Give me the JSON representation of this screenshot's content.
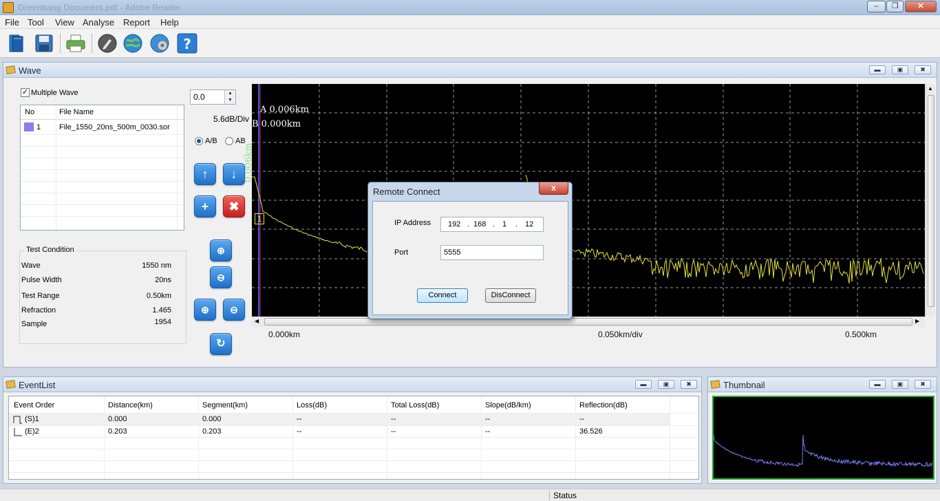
{
  "window": {
    "title": "Greenbang Document.pdf - Adobe Reader"
  },
  "menu": {
    "file": "File",
    "tool": "Tool",
    "view": "View",
    "analyse": "Analyse",
    "report": "Report",
    "help": "Help"
  },
  "toolbar_icons": [
    "open-file-icon",
    "save-icon",
    "print-icon",
    "edit-icon",
    "globe-icon",
    "network-settings-icon",
    "help-icon"
  ],
  "wave": {
    "title": "Wave",
    "multiple_wave_label": "Multiple Wave",
    "multiple_wave_checked": true,
    "table": {
      "col_no": "No",
      "col_file": "File Name",
      "rows": [
        {
          "no": "1",
          "file": "File_1550_20ns_500m_0030.sor",
          "color": "#8b7cf0"
        }
      ]
    },
    "offset_value": "0.0",
    "db_div": "5.6dB/Div",
    "mode_ab_sep": "A/B",
    "mode_ab": "AB",
    "mode_selected": "A/B",
    "test_condition": {
      "title": "Test Condition",
      "rows": [
        {
          "label": "Wave",
          "value": "1550 nm"
        },
        {
          "label": "Pulse Width",
          "value": "20ns"
        },
        {
          "label": "Test Range",
          "value": "0.50km"
        },
        {
          "label": "Refraction",
          "value": "1.465"
        },
        {
          "label": "Sample",
          "value": "1954"
        }
      ]
    },
    "plot": {
      "cursor_a": "A 0.006km",
      "cursor_b": "B 0.000km",
      "cursor_vertical_label": "0.006km",
      "marker": "1",
      "x_start": "0.000km",
      "x_div": "0.050km/div",
      "x_end": "0.500km",
      "trace_color": "#e6e63a"
    }
  },
  "dialog": {
    "title": "Remote Connect",
    "close_glyph": "x",
    "ip_label": "IP Address",
    "ip": [
      "192",
      "168",
      "1",
      "12"
    ],
    "port_label": "Port",
    "port_value": "5555",
    "connect": "Connect",
    "disconnect": "DisConnect"
  },
  "eventlist": {
    "title": "EventList",
    "columns": [
      "Event Order",
      "Distance(km)",
      "Segment(km)",
      "Loss(dB)",
      "Total Loss(dB)",
      "Slope(dB/km)",
      "Reflection(dB)"
    ],
    "rows": [
      [
        "(S)1",
        "0.000",
        "0.000",
        "--",
        "--",
        "--",
        "--"
      ],
      [
        "(E)2",
        "0.203",
        "0.203",
        "--",
        "--",
        "--",
        "36.526"
      ]
    ]
  },
  "thumbnail": {
    "title": "Thumbnail",
    "trace_color": "#7b7cf5",
    "border_color": "#1fb031"
  },
  "status": {
    "text": "Status"
  }
}
